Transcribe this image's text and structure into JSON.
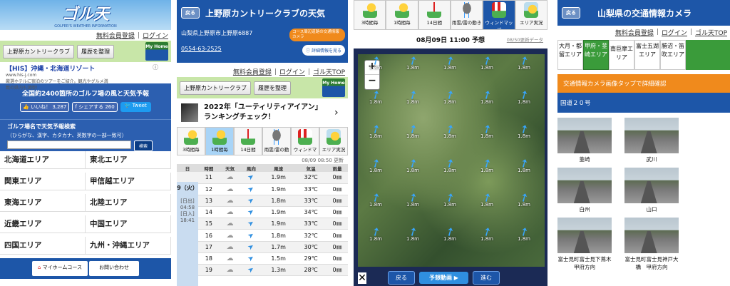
{
  "p1": {
    "logo": "ゴル天",
    "logo_sub": "GOLFER'S WEATHER INFORMATION",
    "links": [
      "無料会員登録",
      "|",
      "ログイン"
    ],
    "buttons": [
      "上野原カントリークラブ",
      "履歴を整理"
    ],
    "myhome": "My Home",
    "ad_title": "【HIS】沖縄・北海道リゾート",
    "ad_url": "www.his-j.com",
    "ad_text1": "厳選ホテルに宿泊のツアーをご紹介。観光やグルメ満",
    "ad_text2": "載の県内も満喫！",
    "promo": "全国約2400箇所のゴルフ場の風と天気予報",
    "like": "いいね！",
    "like_count": "3,287",
    "share": "シェアする",
    "share_count": "260",
    "tweet": "Tweet",
    "search_title": "ゴルフ場名で天気予報検索",
    "search_hint": "（ひらがな、漢字、カタカナ、英数字の一部一致可）",
    "search_btn": "検索",
    "areas": [
      "北海道エリア",
      "東北エリア",
      "関東エリア",
      "甲信越エリア",
      "東海エリア",
      "北陸エリア",
      "近畿エリア",
      "中国エリア",
      "四国エリア",
      "九州・沖縄エリア"
    ],
    "footer": [
      "マイホームコース",
      "お問い合わせ"
    ]
  },
  "p2": {
    "back": "戻る",
    "title": "上野原カントリークラブの天気",
    "address": "山梨県上野原市上野原6887",
    "phone": "0554-63-2525",
    "camera_btn": "コース周辺道路の交通情報カメラ",
    "detail_btn": "詳細情報を見る",
    "links": [
      "無料会員登録",
      "|",
      "ログイン",
      "|",
      "ゴル天TOP"
    ],
    "buttons": [
      "上野原カントリークラブ",
      "履歴を整理"
    ],
    "myhome": "My Home",
    "news": "2022年「ユーティリティアイアン」ランキングチェック！",
    "tabs": [
      "3時間毎",
      "1時間毎",
      "14日間",
      "雨雲/雷の動き",
      "ウィンドマップ",
      "エリア実況"
    ],
    "updated": "08/09 08:50 更新",
    "table_headers": [
      "日",
      "時間",
      "天気",
      "風向",
      "風速",
      "気温",
      "雨量"
    ],
    "day": "9（火）",
    "sunrise_label": "[日出]",
    "sunrise": "04:58",
    "sunset_label": "[日入]",
    "sunset": "18:41",
    "rows": [
      [
        "11",
        "1.9m",
        "32℃",
        "0㎜"
      ],
      [
        "12",
        "1.9m",
        "33℃",
        "0㎜"
      ],
      [
        "13",
        "1.8m",
        "33℃",
        "0㎜"
      ],
      [
        "14",
        "1.9m",
        "34℃",
        "0㎜"
      ],
      [
        "15",
        "1.9m",
        "33℃",
        "0㎜"
      ],
      [
        "16",
        "1.8m",
        "32℃",
        "0㎜"
      ],
      [
        "17",
        "1.7m",
        "30℃",
        "0㎜"
      ],
      [
        "18",
        "1.5m",
        "29℃",
        "0㎜"
      ],
      [
        "19",
        "1.3m",
        "28℃",
        "0㎜"
      ]
    ]
  },
  "p3": {
    "tabs": [
      "3時間毎",
      "1時間毎",
      "14日間",
      "雨雲/雷の動き",
      "ウィンドマップ",
      "エリア実況"
    ],
    "forecast_time": "08月09日 11:00 予想",
    "updated": "08/50更新データ",
    "zoom_in": "+",
    "zoom_out": "−",
    "wind_value": "1.8m",
    "back": "戻る",
    "play": "予想動画",
    "forward": "進む",
    "close": "✕"
  },
  "p4": {
    "back": "戻る",
    "title": "山梨県の交通情報カメラ",
    "links": [
      "無料会員登録",
      "|",
      "ログイン",
      "|",
      "ゴル天TOP"
    ],
    "area_tabs": [
      "大月・都留エリア",
      "甲府・韮崎エリア",
      "南巨摩エリア",
      "富士五湖エリア",
      "勝沼・笛吹エリア"
    ],
    "notice": "交通情報カメラ画像タップで詳細確認",
    "route": "国道２０号",
    "cams": [
      "韮崎",
      "武川",
      "白州",
      "山口",
      "富士見町富士見下蔦木　甲府方向",
      "富士見町富士見神戸大橋　甲府方向"
    ]
  },
  "colors": {
    "brand_blue": "#1d56a8",
    "orange": "#f08a1c",
    "accent_green": "#3a9b3a"
  }
}
